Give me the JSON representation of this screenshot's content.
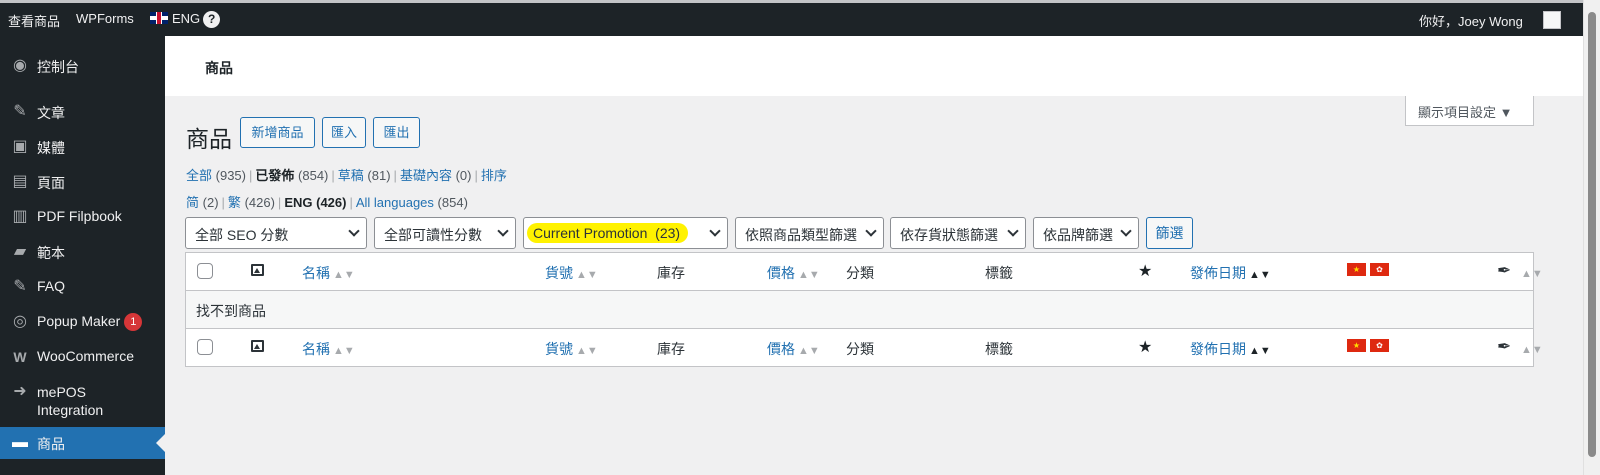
{
  "admin_bar": {
    "view_products": "查看商品",
    "wpforms": "WPForms",
    "language": "ENG",
    "help": "?",
    "greeting": "你好，Joey Wong"
  },
  "sidebar": {
    "items": [
      {
        "label": "控制台",
        "icon": "dashboard-icon"
      },
      {
        "label": "文章",
        "icon": "pin-icon"
      },
      {
        "label": "媒體",
        "icon": "media-icon"
      },
      {
        "label": "頁面",
        "icon": "page-icon"
      },
      {
        "label": "PDF Filpbook",
        "icon": "book-icon"
      },
      {
        "label": "範本",
        "icon": "folder-icon"
      },
      {
        "label": "FAQ",
        "icon": "pin-icon"
      },
      {
        "label": "Popup Maker",
        "icon": "popup-icon",
        "badge": "1"
      },
      {
        "label": "WooCommerce",
        "icon": "woo-icon"
      },
      {
        "label_line1": "mePOS",
        "label_line2": "Integration",
        "icon": "login-icon"
      },
      {
        "label": "商品",
        "icon": "archive-icon"
      }
    ]
  },
  "header": {
    "title": "商品"
  },
  "screen_options": "顯示項目設定 ▼",
  "page": {
    "title": "商品",
    "buttons": [
      "新增商品",
      "匯入",
      "匯出"
    ]
  },
  "status_filters": {
    "all": "全部",
    "all_count": "(935)",
    "published": "已發佈",
    "published_count": "(854)",
    "draft": "草稿",
    "draft_count": "(81)",
    "cornerstone": "基礎內容",
    "cornerstone_count": "(0)",
    "sort": "排序"
  },
  "language_filters": {
    "simplified": "简",
    "simplified_count": "(2)",
    "traditional": "繁",
    "traditional_count": "(426)",
    "eng": "ENG",
    "eng_count": "(426)",
    "all_languages": "All languages",
    "all_languages_count": "(854)"
  },
  "filters": {
    "seo": "全部 SEO 分數",
    "readability": "全部可讀性分數",
    "promotion": "Current Promotion  (23)",
    "product_type": "依照商品類型篩選",
    "stock_status": "依存貨狀態篩選",
    "brand": "依品牌篩選",
    "submit": "篩選"
  },
  "table": {
    "columns": {
      "name": "名稱",
      "sku": "貨號",
      "stock": "庫存",
      "price": "價格",
      "category": "分類",
      "tags": "標籤",
      "date": "發佈日期"
    },
    "sort_glyph": "▲▼",
    "date_sort_glyph": "▲▼",
    "empty_message": "找不到商品"
  },
  "colors": {
    "accent": "#2271b1",
    "sidebar": "#1d2327",
    "highlight": "#fff200"
  }
}
